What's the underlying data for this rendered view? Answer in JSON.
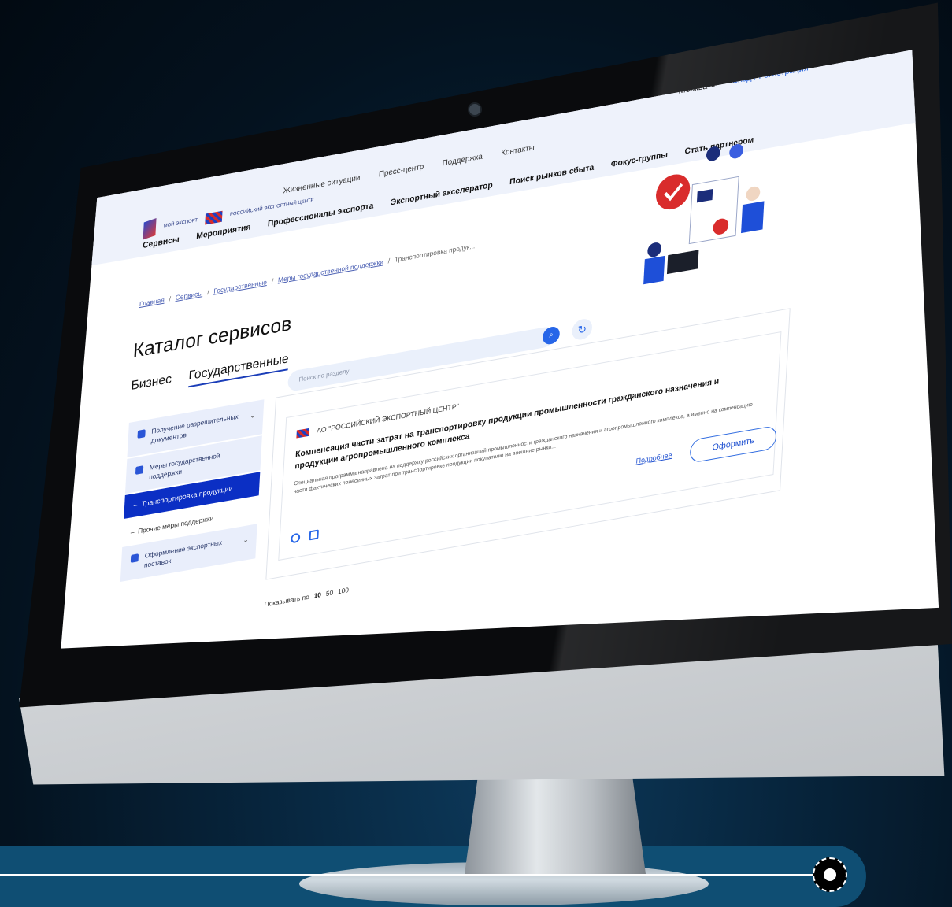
{
  "header": {
    "logo_moy": "МОЙ ЭКСПОРТ",
    "logo_rec": "РОССИЙСКИЙ ЭКСПОРТНЫЙ ЦЕНТР",
    "city": "Москва ⌄",
    "login": "Вход / Регистрация",
    "nav_top": [
      "Жизненные ситуации",
      "Пресс-центр",
      "Поддержка",
      "Контакты"
    ],
    "nav_main": [
      "Сервисы",
      "Мероприятия",
      "Профессионалы экспорта",
      "Экспортный акселератор",
      "Поиск рынков сбыта",
      "Фокус-группы",
      "Стать партнером"
    ]
  },
  "breadcrumb": [
    "Главная",
    "Сервисы",
    "Государственные",
    "Меры государственной поддержки",
    "Транспортировка продук..."
  ],
  "page": {
    "title": "Каталог сервисов",
    "tabs": [
      "Бизнес",
      "Государственные"
    ]
  },
  "sidebar": {
    "items": [
      "Получение разрешительных документов",
      "Меры государственной поддержки",
      "Транспортировка продукции",
      "Прочие меры поддержки",
      "Оформление экспортных поставок"
    ]
  },
  "search": {
    "placeholder": "Поиск по разделу"
  },
  "card": {
    "org": "АО \"РОССИЙСКИЙ ЭКСПОРТНЫЙ ЦЕНТР\"",
    "title": "Компенсация части затрат на транспортировку продукции промышленности гражданского назначения и продукции агропромышленного комплекса",
    "desc": "Специальная программа направлена на поддержку российских организаций промышленности гражданского назначения и агропромышленного комплекса, а именно на компенсацию части фактических понесенных затрат при транспортировке продукции покупателю на внешние рынки...",
    "more": "Подробнее",
    "apply": "Оформить"
  },
  "pager": {
    "label": "Показывать по",
    "options": [
      "10",
      "50",
      "100"
    ]
  },
  "colors": {
    "accent": "#0b2fc4",
    "link": "#1d4fd0",
    "background": "#04121f"
  }
}
